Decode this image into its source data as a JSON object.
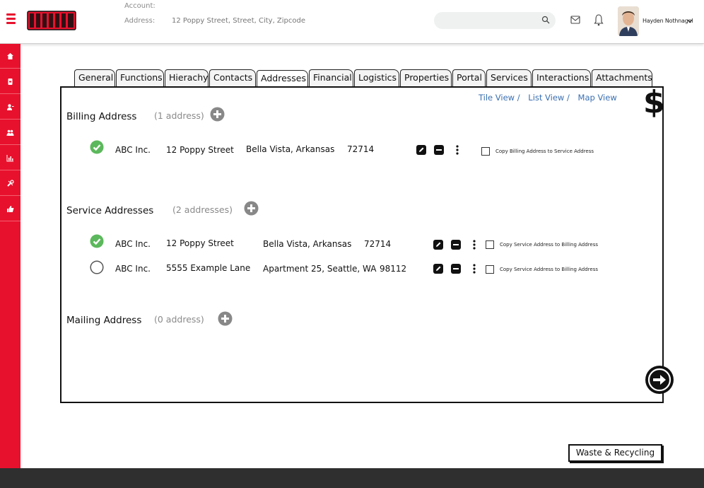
{
  "header": {
    "account_label": "Account:",
    "address_label": "Address:",
    "address_value": "12 Poppy Street, Street, City, Zipcode",
    "search_placeholder": "",
    "user_name": "Hayden Nothnagel"
  },
  "tabs": [
    {
      "label": "General"
    },
    {
      "label": "Functions"
    },
    {
      "label": "Hierachy"
    },
    {
      "label": "Contacts"
    },
    {
      "label": "Addresses"
    },
    {
      "label": "Financial"
    },
    {
      "label": "Logistics"
    },
    {
      "label": "Properties"
    },
    {
      "label": "Portal"
    },
    {
      "label": "Services"
    },
    {
      "label": "Interactions"
    },
    {
      "label": "Attachments"
    }
  ],
  "active_tab": "Addresses",
  "views": {
    "tile": "Tile View /",
    "list": "List View /",
    "map": "Map View"
  },
  "dollar_symbol": "$",
  "billing": {
    "title": "Billing Address",
    "count": "(1 address)",
    "rows": [
      {
        "name": "ABC Inc.",
        "street": "12 Poppy Street",
        "city": "Bella Vista, Arkansas",
        "zip": "72714",
        "primary": true,
        "copy_label": "Copy Billing Address to Service Address"
      }
    ]
  },
  "service": {
    "title": "Service Addresses",
    "count": "(2 addresses)",
    "rows": [
      {
        "name": "ABC Inc.",
        "street": "12 Poppy Street",
        "city": "Bella Vista, Arkansas",
        "zip": "72714",
        "primary": true,
        "copy_label": "Copy Service Address to Billing Address"
      },
      {
        "name": "ABC Inc.",
        "street": "5555 Example Lane",
        "city": "Apartment 25, Seattle, WA",
        "zip": "98112",
        "primary": false,
        "copy_label": "Copy Service Address to Billing Address"
      }
    ]
  },
  "mailing": {
    "title": "Mailing Address",
    "count": "(0 address)"
  },
  "footer_button": "Waste & Recycling",
  "colors": {
    "brand_red": "#e8112d",
    "check_green": "#5cb85c",
    "link_blue": "#3a6fb0",
    "footer": "#2f2f2f"
  },
  "icons": {
    "sidebar": [
      "home-icon",
      "ticket-icon",
      "user-icon",
      "group-icon",
      "chart-icon",
      "tools-icon",
      "thumbs-up-icon"
    ]
  }
}
